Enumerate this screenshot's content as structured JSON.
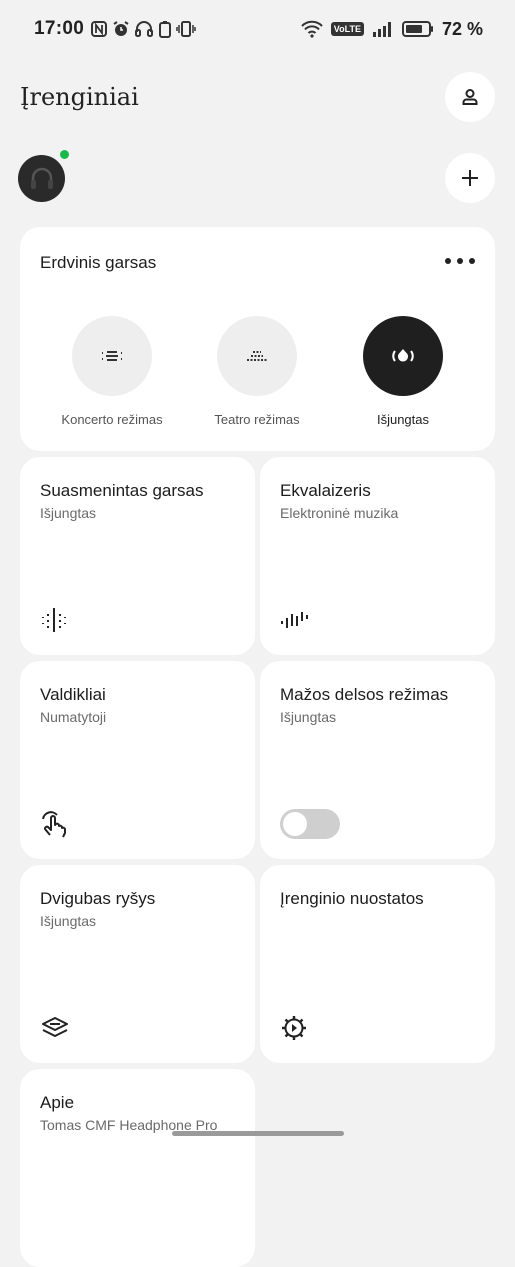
{
  "status_bar": {
    "time": "17:00",
    "volte": "VoLTE",
    "battery_percent": "72 %",
    "icons": [
      "nfc-icon",
      "alarm-icon",
      "headphones-icon",
      "battery-device-icon",
      "vibrate-icon",
      "wifi-icon",
      "signal-icon",
      "battery-icon"
    ]
  },
  "header": {
    "title": "Įrenginiai",
    "profile_icon": "person-icon",
    "add_icon": "plus-icon"
  },
  "spatial_audio": {
    "title": "Erdvinis garsas",
    "more_icon": "more-dots-icon",
    "modes": [
      {
        "label": "Koncerto režimas",
        "icon": "concert-mode-icon",
        "active": false
      },
      {
        "label": "Teatro režimas",
        "icon": "theater-mode-icon",
        "active": false
      },
      {
        "label": "Išjungtas",
        "icon": "spatial-off-icon",
        "active": true
      }
    ]
  },
  "tiles": [
    {
      "title": "Suasmenintas garsas",
      "subtitle": "Išjungtas",
      "icon": "personal-sound-icon"
    },
    {
      "title": "Ekvalaizeris",
      "subtitle": "Elektroninė muzika",
      "icon": "equalizer-icon"
    },
    {
      "title": "Valdikliai",
      "subtitle": "Numatytoji",
      "icon": "touch-gesture-icon"
    },
    {
      "title": "Mažos delsos režimas",
      "subtitle": "Išjungtas",
      "toggle_on": false
    },
    {
      "title": "Dvigubas ryšys",
      "subtitle": "Išjungtas",
      "icon": "dual-connection-icon"
    },
    {
      "title": "Įrenginio nuostatos",
      "subtitle": "",
      "icon": "gear-icon"
    },
    {
      "title": "Apie",
      "subtitle": "Tomas CMF Headphone Pro"
    }
  ],
  "colors": {
    "background": "#f2f2f2",
    "card": "#ffffff",
    "active_mode": "#1f1f1f",
    "online": "#19b84a"
  }
}
